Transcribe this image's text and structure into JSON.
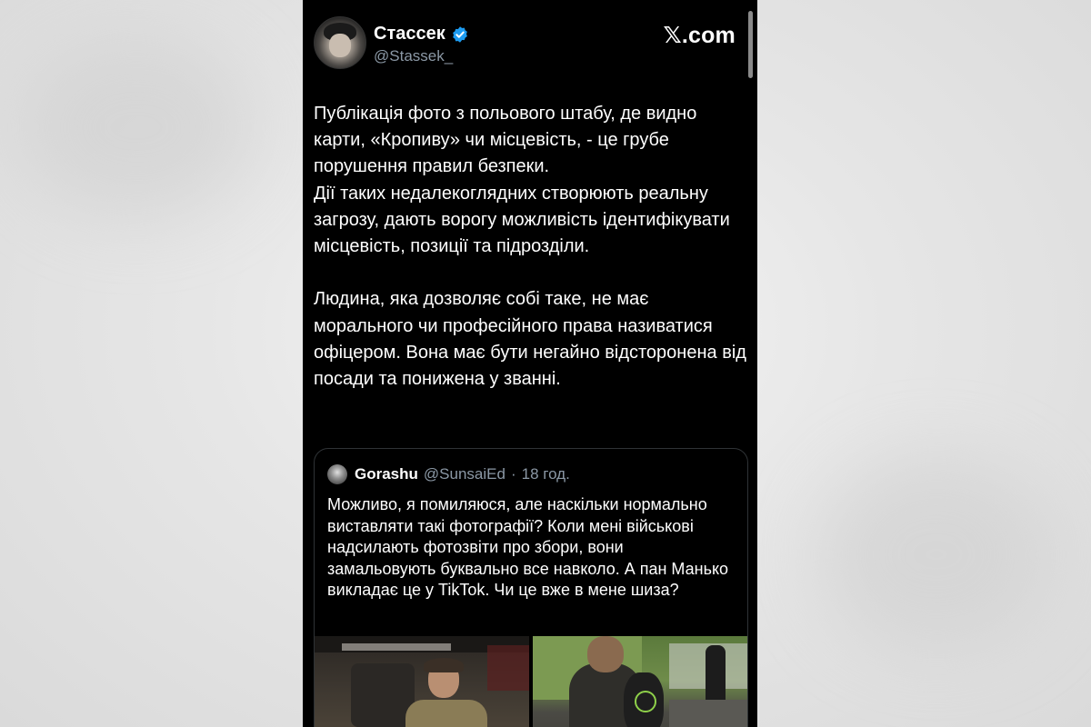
{
  "brand": {
    "label": "𝕏.com"
  },
  "author": {
    "display_name": "Стассек",
    "handle": "@Stassek_"
  },
  "tweet": {
    "text": "Публікація фото з польового штабу, де видно карти, «Кропиву» чи місцевість, - це грубе порушення правил безпеки.\nДії таких недалекоглядних створюють реальну загрозу, дають ворогу можливість ідентифікувати місцевість, позиції та підрозділи.\n\nЛюдина, яка дозволяє собі таке, не має морального чи професійного права називатися офіцером. Вона має бути негайно відсторонена від посади та понижена у званні."
  },
  "quoted_tweet": {
    "display_name": "Gorashu",
    "handle": "@SunsaiEd",
    "separator": "·",
    "time": "18 год.",
    "text": "Можливо, я помиляюся, але наскільки нормально виставляти такі фотографії? Коли мені військові надсилають фотозвіти про збори, вони замальовують буквально все навколо. А пан Манько викладає це у TikTok. Чи це вже в мене шиза?"
  },
  "colors": {
    "background": "#000000",
    "text": "#ffffff",
    "secondary_text": "#8b98a5",
    "verified": "#1d9bf0",
    "border": "#2f3336"
  }
}
